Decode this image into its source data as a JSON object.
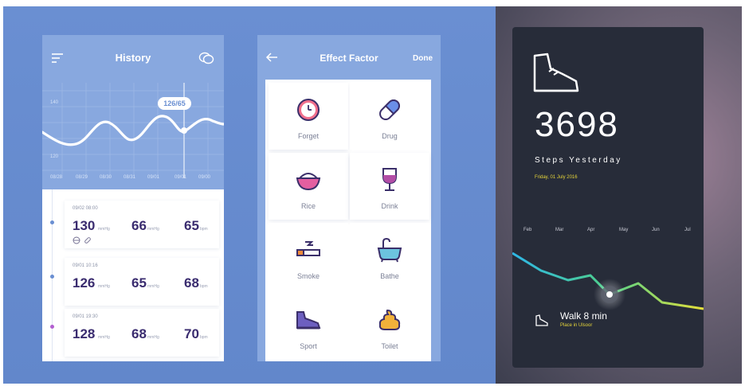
{
  "history": {
    "title": "History",
    "icons": {
      "menu": "menu-icon",
      "chat": "chat-bubbles-icon"
    },
    "chart": {
      "y_labels": [
        "140",
        "120"
      ],
      "x_labels": [
        "08/28",
        "08/29",
        "08/30",
        "08/31",
        "09/01",
        "09/01",
        "09/00"
      ],
      "tooltip": "126/65"
    },
    "records": [
      {
        "datetime": "09/02 08:00",
        "sys": "130",
        "sys_unit": "mmHg",
        "dia": "66",
        "dia_unit": "mmHg",
        "pulse": "65",
        "pulse_unit": "bpm",
        "dot_color": "#6a8fd2"
      },
      {
        "datetime": "09/01 10:16",
        "sys": "126",
        "sys_unit": "mmHg",
        "dia": "65",
        "dia_unit": "mmHg",
        "pulse": "68",
        "pulse_unit": "bpm",
        "dot_color": "#6a8fd2"
      },
      {
        "datetime": "09/01 19:30",
        "sys": "128",
        "sys_unit": "mmHg",
        "dia": "68",
        "dia_unit": "mmHg",
        "pulse": "70",
        "pulse_unit": "bpm",
        "dot_color": "#b25fd0"
      }
    ]
  },
  "effect": {
    "title": "Effect Factor",
    "done_label": "Done",
    "factors": [
      {
        "label": "Forget",
        "icon": "clock-icon"
      },
      {
        "label": "Drug",
        "icon": "pill-icon"
      },
      {
        "label": "Rice",
        "icon": "rice-bowl-icon"
      },
      {
        "label": "Drink",
        "icon": "wine-glass-icon"
      },
      {
        "label": "Smoke",
        "icon": "cigarette-icon"
      },
      {
        "label": "Bathe",
        "icon": "bathtub-icon"
      },
      {
        "label": "Sport",
        "icon": "sneaker-icon"
      },
      {
        "label": "Toilet",
        "icon": "poop-icon"
      }
    ]
  },
  "steps": {
    "count": "3698",
    "label": "Steps Yesterday",
    "date": "Friday, 01 July 2016",
    "months": [
      "Feb",
      "Mar",
      "Apr",
      "May",
      "Jun",
      "Jul"
    ],
    "walk_title": "Walk 8 min",
    "walk_place": "Place in Ulsoor"
  }
}
